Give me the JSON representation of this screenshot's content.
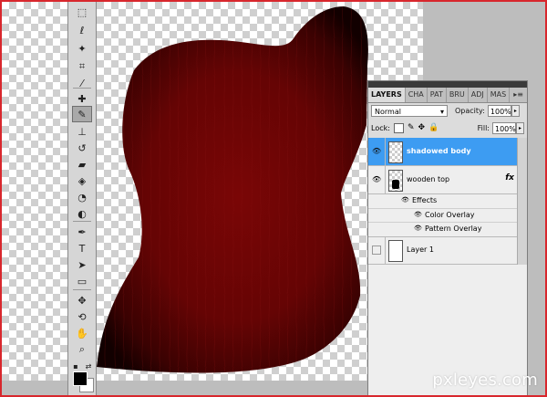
{
  "panel": {
    "tabs": [
      "LAYERS",
      "CHA",
      "PAT",
      "BRU",
      "ADJ",
      "MAS"
    ],
    "menu_icon": "▸≡",
    "blend_mode": "Normal",
    "opacity_label": "Opacity:",
    "opacity_value": "100%",
    "lock_label": "Lock:",
    "fill_label": "Fill:",
    "fill_value": "100%",
    "layers": [
      {
        "name": "shadowed body",
        "selected": true,
        "visible": true
      },
      {
        "name": "wooden top",
        "selected": false,
        "visible": true,
        "fx": "fx"
      },
      {
        "name": "Layer 1",
        "selected": false,
        "visible": false
      }
    ],
    "effects": {
      "title": "Effects",
      "items": [
        "Color Overlay",
        "Pattern Overlay"
      ]
    }
  },
  "watermark": "pxleyes.com",
  "colors": {
    "selection": "#3d9cf2",
    "guitar_body": "#6b0505",
    "frame_border": "#d8272d"
  }
}
